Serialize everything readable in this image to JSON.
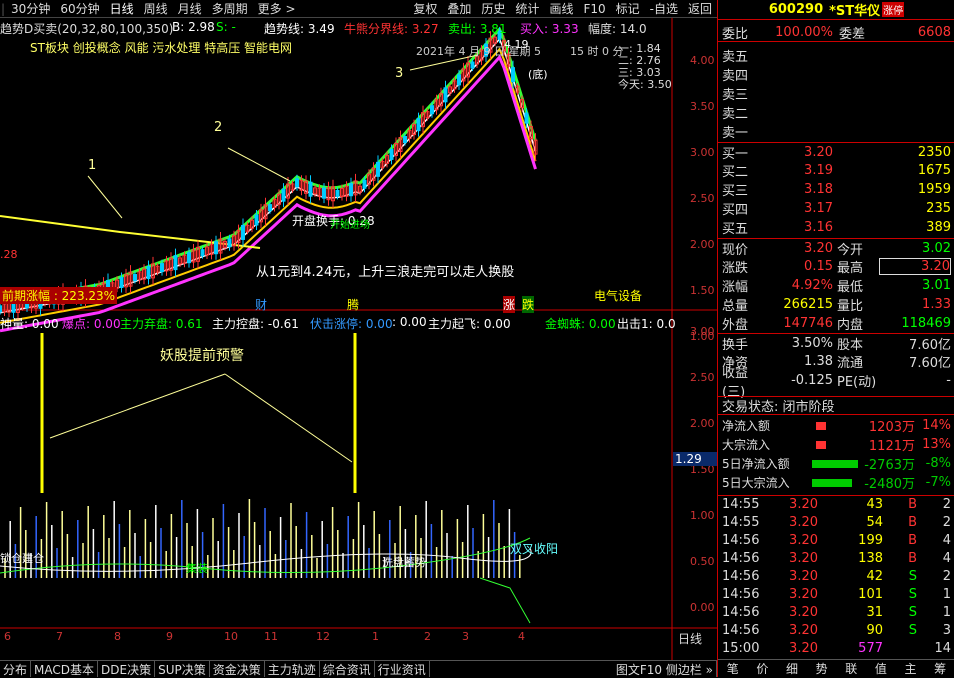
{
  "toolbar": {
    "items": [
      "30分钟",
      "60分钟",
      "日线",
      "周线",
      "月线",
      "多周期",
      "更多 >"
    ],
    "right": [
      "复权",
      "叠加",
      "历史",
      "统计",
      "画线",
      "F10",
      "标记",
      "-自选",
      "返回"
    ]
  },
  "indicator_top": {
    "name": "趋势D买卖(20,32,80,100,350)",
    "b": "B: 2.98",
    "s": "S: -",
    "trend": "趋势线: 3.49",
    "bull": "牛熊分界线: 3.27",
    "sell": "卖出: 3.81",
    "buy": "买入: 3.33",
    "amp": "幅度: 14.0"
  },
  "sector_line": "ST板块 创投概念 风能 污水处理 特高压 智能电网",
  "date_box": {
    "date": "2021年 4 月 9 日 星期 5",
    "time": "15 时 0 分",
    "l1": "一: 1.84",
    "l2": "二: 2.76",
    "l3": "三: 3.03",
    "today": "今天: 3.50"
  },
  "annotations": {
    "a1": "1",
    "a2": "2",
    "a3": "3",
    "top_price": "4.19",
    "low_tag": "(底)",
    "turnover": "开盘换手: 0.28",
    "summary": "从1元到4.24元，上升三浪走完可以走人换股",
    "left_tag": "前期涨幅 : 223.23%",
    "left_price": ".28",
    "sector": "电气设备",
    "cai": "财",
    "teng": "腾",
    "zhang": "涨",
    "die": "跌",
    "label_warn": "妖股提前预警",
    "label_cross": "双叉收阳",
    "label_lock": "锁仓建仓",
    "label_ji": "集装",
    "label_xi": "洗盘蓄势",
    "label_jian": "开始进场"
  },
  "indicator_bottom": {
    "shen": "神量: 0.00",
    "bao": "爆点: 0.00",
    "qi": "主力弃盘: 0.61",
    "kong": "主力控盘: -0.61",
    "fu": "伏击涨停: 0.00",
    "z": ": 0.00",
    "qif": "主力起飞: 0.00",
    "jin": "金蜘蛛: 0.00",
    "chu": "出击1: 0.0"
  },
  "price_axis": [
    "4.00",
    "3.50",
    "3.00",
    "2.50",
    "2.00",
    "1.50",
    "1.00"
  ],
  "sub_axis": [
    "3.00",
    "2.50",
    "2.00",
    "1.50",
    "1.00",
    "0.50",
    "0.00"
  ],
  "sub_value": "1.29",
  "x_labels": [
    "6",
    "7",
    "8",
    "9",
    "10",
    "11",
    "12",
    "1",
    "2",
    "3",
    "4"
  ],
  "x_period": "日线",
  "bottom_tabs": [
    "分布",
    "MACD基本",
    "DDE决策",
    "SUP决策",
    "资金决策",
    "主力轨迹",
    "综合资讯",
    "行业资讯"
  ],
  "bottom_right": "图文F10 侧边栏 »",
  "stock": {
    "code": "600290",
    "name": "*ST华仪",
    "tag": "涨停"
  },
  "weibi": {
    "label": "委比",
    "value": "100.00%",
    "diff_label": "委差",
    "diff": "6608"
  },
  "asks": [
    {
      "label": "卖五"
    },
    {
      "label": "卖四"
    },
    {
      "label": "卖三"
    },
    {
      "label": "卖二"
    },
    {
      "label": "卖一"
    }
  ],
  "bids": [
    {
      "label": "买一",
      "price": "3.20",
      "vol": "2350"
    },
    {
      "label": "买二",
      "price": "3.19",
      "vol": "1675"
    },
    {
      "label": "买三",
      "price": "3.18",
      "vol": "1959"
    },
    {
      "label": "买四",
      "price": "3.17",
      "vol": "235"
    },
    {
      "label": "买五",
      "price": "3.16",
      "vol": "389"
    }
  ],
  "quote": [
    {
      "l1": "现价",
      "v1": "3.20",
      "l2": "今开",
      "v2": "3.02"
    },
    {
      "l1": "涨跌",
      "v1": "0.15",
      "l2": "最高",
      "v2": "3.20"
    },
    {
      "l1": "涨幅",
      "v1": "4.92%",
      "l2": "最低",
      "v2": "3.01"
    },
    {
      "l1": "总量",
      "v1": "266215",
      "l2": "量比",
      "v2": "1.33"
    },
    {
      "l1": "外盘",
      "v1": "147746",
      "l2": "内盘",
      "v2": "118469"
    },
    {
      "l1": "换手",
      "v1": "3.50%",
      "l2": "股本",
      "v2": "7.60亿"
    },
    {
      "l1": "净资",
      "v1": "1.38",
      "l2": "流通",
      "v2": "7.60亿"
    },
    {
      "l1": "收益(三)",
      "v1": "-0.125",
      "l2": "PE(动)",
      "v2": "-"
    }
  ],
  "trade_state": "交易状态: 闭市阶段",
  "flows": [
    {
      "label": "净流入额",
      "value": "1203万",
      "pct": "14%",
      "color": "#ff3333",
      "w": 10
    },
    {
      "label": "大宗流入",
      "value": "1121万",
      "pct": "13%",
      "color": "#ff3333",
      "w": 10
    },
    {
      "label": "5日净流入额",
      "value": "-2763万",
      "pct": "-8%",
      "color": "#00cc00",
      "w": 46
    },
    {
      "label": "5日大宗流入",
      "value": "-2480万",
      "pct": "-7%",
      "color": "#00cc00",
      "w": 40
    }
  ],
  "ticks": [
    {
      "t": "14:55",
      "p": "3.20",
      "v": "43",
      "d": "B",
      "n": "2"
    },
    {
      "t": "14:55",
      "p": "3.20",
      "v": "54",
      "d": "B",
      "n": "2"
    },
    {
      "t": "14:56",
      "p": "3.20",
      "v": "199",
      "d": "B",
      "n": "4"
    },
    {
      "t": "14:56",
      "p": "3.20",
      "v": "138",
      "d": "B",
      "n": "4"
    },
    {
      "t": "14:56",
      "p": "3.20",
      "v": "42",
      "d": "S",
      "n": "2"
    },
    {
      "t": "14:56",
      "p": "3.20",
      "v": "101",
      "d": "S",
      "n": "1"
    },
    {
      "t": "14:56",
      "p": "3.20",
      "v": "31",
      "d": "S",
      "n": "1"
    },
    {
      "t": "14:56",
      "p": "3.20",
      "v": "90",
      "d": "S",
      "n": "3"
    },
    {
      "t": "15:00",
      "p": "3.20",
      "v": "577",
      "d": "",
      "n": "14"
    }
  ],
  "rtabs": [
    "笔",
    "价",
    "细",
    "势",
    "联",
    "值",
    "主",
    "筹"
  ]
}
